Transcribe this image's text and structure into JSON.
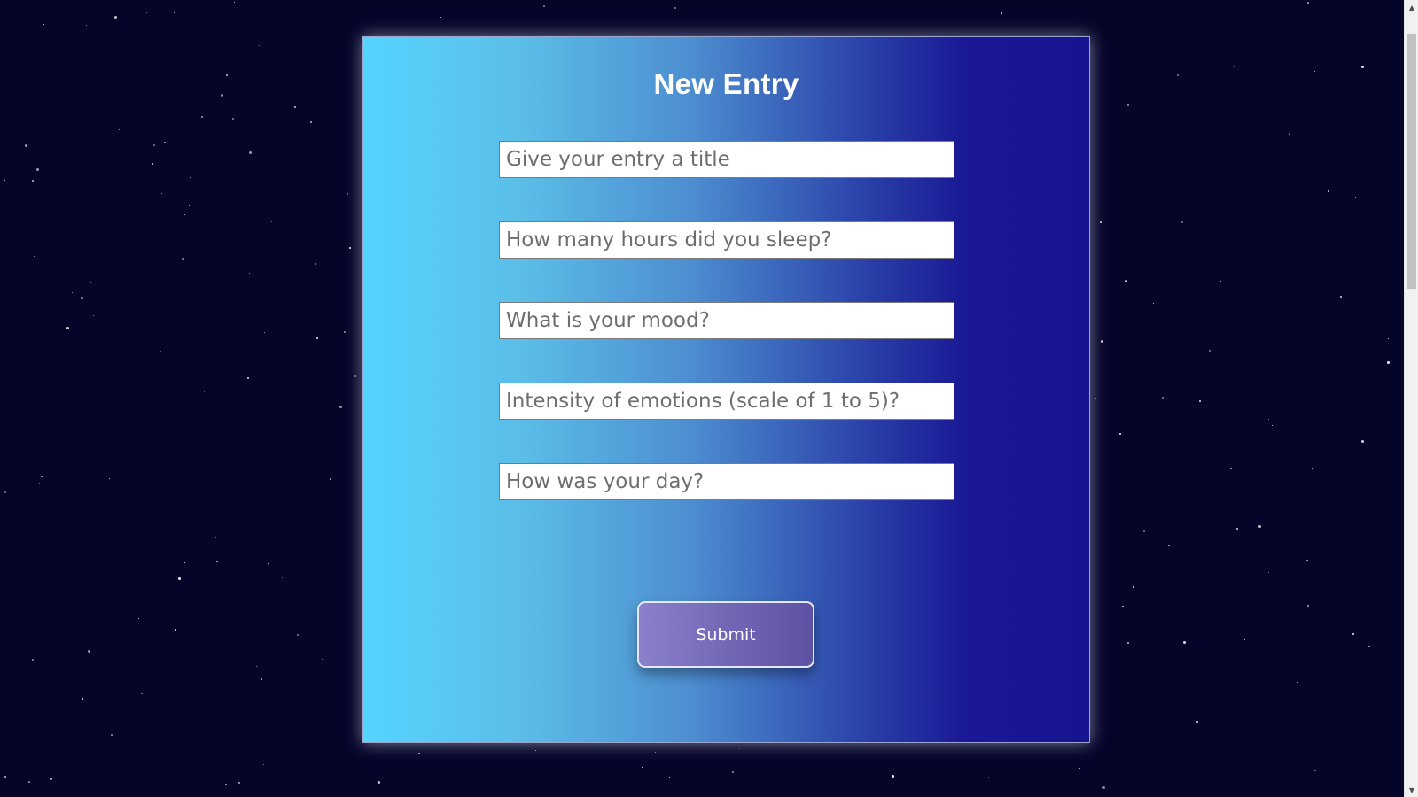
{
  "form": {
    "title": "New Entry",
    "fields": [
      {
        "name": "entry-title",
        "placeholder": "Give your entry a title",
        "value": ""
      },
      {
        "name": "sleep-hours",
        "placeholder": "How many hours did you sleep?",
        "value": ""
      },
      {
        "name": "mood",
        "placeholder": "What is your mood?",
        "value": ""
      },
      {
        "name": "emotion-intensity",
        "placeholder": "Intensity of emotions (scale of 1 to 5)?",
        "value": ""
      },
      {
        "name": "day-description",
        "placeholder": "How was your day?",
        "value": ""
      }
    ],
    "submit_label": "Submit"
  },
  "scrollbar": {
    "up_icon": "chevron-up-icon",
    "down_icon": "chevron-down-icon"
  },
  "colors": {
    "background": "#05052a",
    "card_gradient_start": "#55d4ff",
    "card_gradient_end": "#171490",
    "button_gradient_start": "#8a80cc",
    "button_gradient_end": "#5d51a4",
    "title_text": "#ffffff"
  }
}
